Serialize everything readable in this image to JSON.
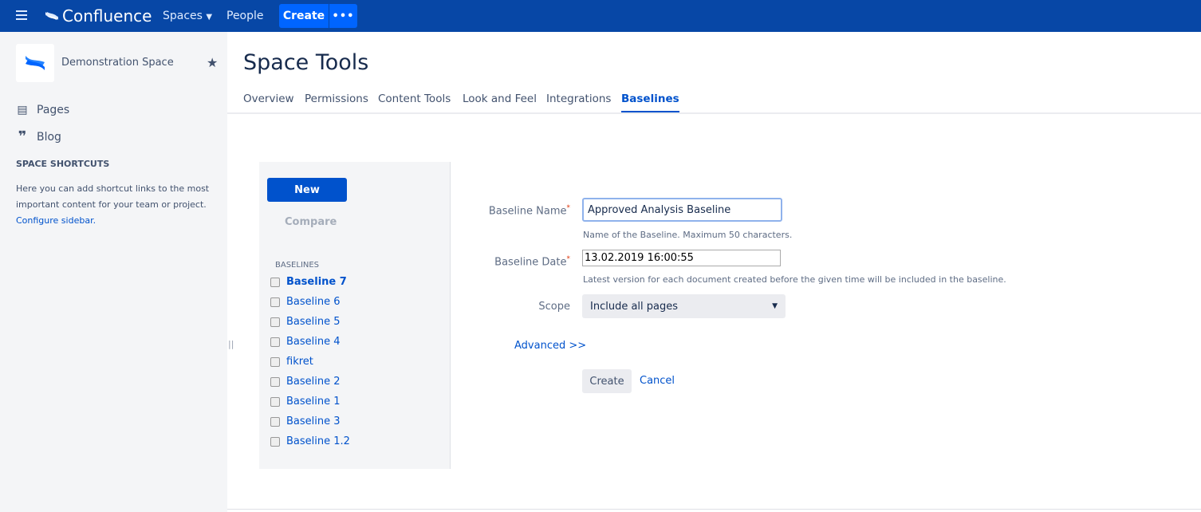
{
  "topbar": {
    "product": "Confluence",
    "spaces": "Spaces",
    "people": "People",
    "create": "Create",
    "more": "•••"
  },
  "sidebar": {
    "space_name": "Demonstration Space",
    "items": [
      {
        "label": "Pages",
        "icon": "page-icon"
      },
      {
        "label": "Blog",
        "icon": "quote-icon"
      }
    ],
    "shortcuts_heading": "SPACE SHORTCUTS",
    "shortcuts_text": "Here you can add shortcut links to the most important content for your team or project.",
    "configure_link": "Configure sidebar."
  },
  "page": {
    "title": "Space Tools",
    "tabs": [
      "Overview",
      "Permissions",
      "Content Tools",
      "Look and Feel",
      "Integrations",
      "Baselines"
    ],
    "active_tab": "Baselines"
  },
  "baselines_panel": {
    "new_label": "New",
    "compare_label": "Compare",
    "heading": "BASELINES",
    "items": [
      "Baseline 7",
      "Baseline 6",
      "Baseline 5",
      "Baseline 4",
      "fikret",
      "Baseline 2",
      "Baseline 1",
      "Baseline 3",
      "Baseline 1.2"
    ],
    "selected": "Baseline 7"
  },
  "form": {
    "name_label": "Baseline Name",
    "name_value": "Approved Analysis Baseline",
    "name_hint": "Name of the Baseline. Maximum 50 characters.",
    "date_label": "Baseline Date",
    "date_value": "13.02.2019 16:00:55",
    "date_hint": "Latest version for each document created before the given time will be included in the baseline.",
    "required_mark": "*",
    "scope_label": "Scope",
    "scope_value": "Include all pages",
    "advanced": "Advanced >>",
    "create": "Create",
    "cancel": "Cancel"
  },
  "colors": {
    "topbar": "#0747a6",
    "accent": "#0052cc",
    "sidebar_bg": "#f4f5f7"
  }
}
